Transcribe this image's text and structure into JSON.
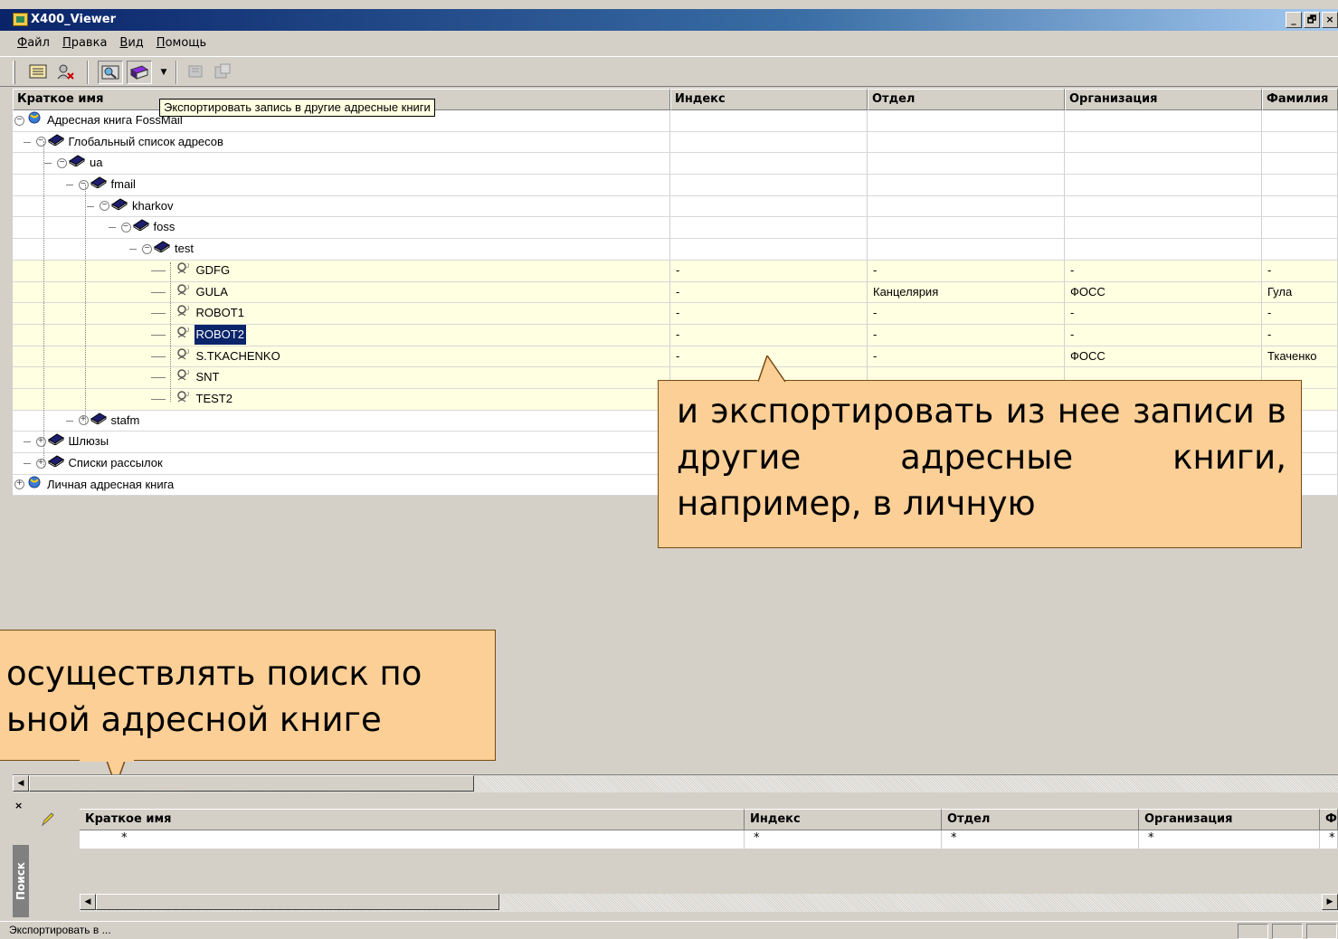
{
  "window": {
    "title": "X400_Viewer",
    "min": "_",
    "max": "🗗",
    "close": "×"
  },
  "menu": [
    "Файл",
    "Правка",
    "Вид",
    "Помощь"
  ],
  "tooltip": "Экспортировать запись в другие адресные книги",
  "columns": [
    "Краткое имя",
    "Индекс",
    "Отдел",
    "Организация",
    "Фамилия"
  ],
  "tree": [
    {
      "label": "Адресная книга FossMail",
      "icon": "globe-book-icon",
      "exp": "−"
    },
    {
      "label": "Глобальный список адресов",
      "icon": "book-icon",
      "exp": "−"
    },
    {
      "label": "ua",
      "icon": "book-icon",
      "exp": "−"
    },
    {
      "label": "fmail",
      "icon": "book-icon",
      "exp": "−"
    },
    {
      "label": "kharkov",
      "icon": "book-icon",
      "exp": "−"
    },
    {
      "label": "foss",
      "icon": "book-icon",
      "exp": "−"
    },
    {
      "label": "test",
      "icon": "book-icon",
      "exp": "−"
    },
    {
      "label": "GDFG",
      "icon": "user-icon",
      "index": "-",
      "dept": "-",
      "org": "-",
      "surname": "-"
    },
    {
      "label": "GULA",
      "icon": "user-icon",
      "index": "-",
      "dept": "Канцелярия",
      "org": "ФОСС",
      "surname": "Гула"
    },
    {
      "label": "ROBOT1",
      "icon": "user-icon",
      "index": "-",
      "dept": "-",
      "org": "-",
      "surname": "-"
    },
    {
      "label": "ROBOT2",
      "icon": "user-icon",
      "index": "-",
      "dept": "-",
      "org": "-",
      "surname": "-"
    },
    {
      "label": "S.TKACHENKO",
      "icon": "user-icon",
      "index": "-",
      "dept": "-",
      "org": "ФОСС",
      "surname": "Ткаченко"
    },
    {
      "label": "SNT",
      "icon": "user-icon"
    },
    {
      "label": "TEST2",
      "icon": "user-icon"
    },
    {
      "label": "stafm",
      "icon": "book-icon",
      "exp": "+"
    },
    {
      "label": "Шлюзы",
      "icon": "book-icon",
      "exp": "+"
    },
    {
      "label": "Списки рассылок",
      "icon": "book-icon",
      "exp": "+"
    },
    {
      "label": "Личная адресная книга",
      "icon": "globe-book-icon",
      "exp": "+"
    }
  ],
  "callouts": {
    "right": "и экспортировать из нее записи в другие адресные книги, например, в личную",
    "left_line1": "осуществлять поиск по",
    "left_line2": "ьной адресной книге"
  },
  "search": {
    "tab_label": "Поиск",
    "close": "×",
    "columns": [
      "Краткое имя",
      "Индекс",
      "Отдел",
      "Организация",
      "Ф"
    ],
    "row": [
      "*",
      "*",
      "*",
      "*",
      "*"
    ]
  },
  "status": {
    "text": "Экспортировать в ..."
  }
}
